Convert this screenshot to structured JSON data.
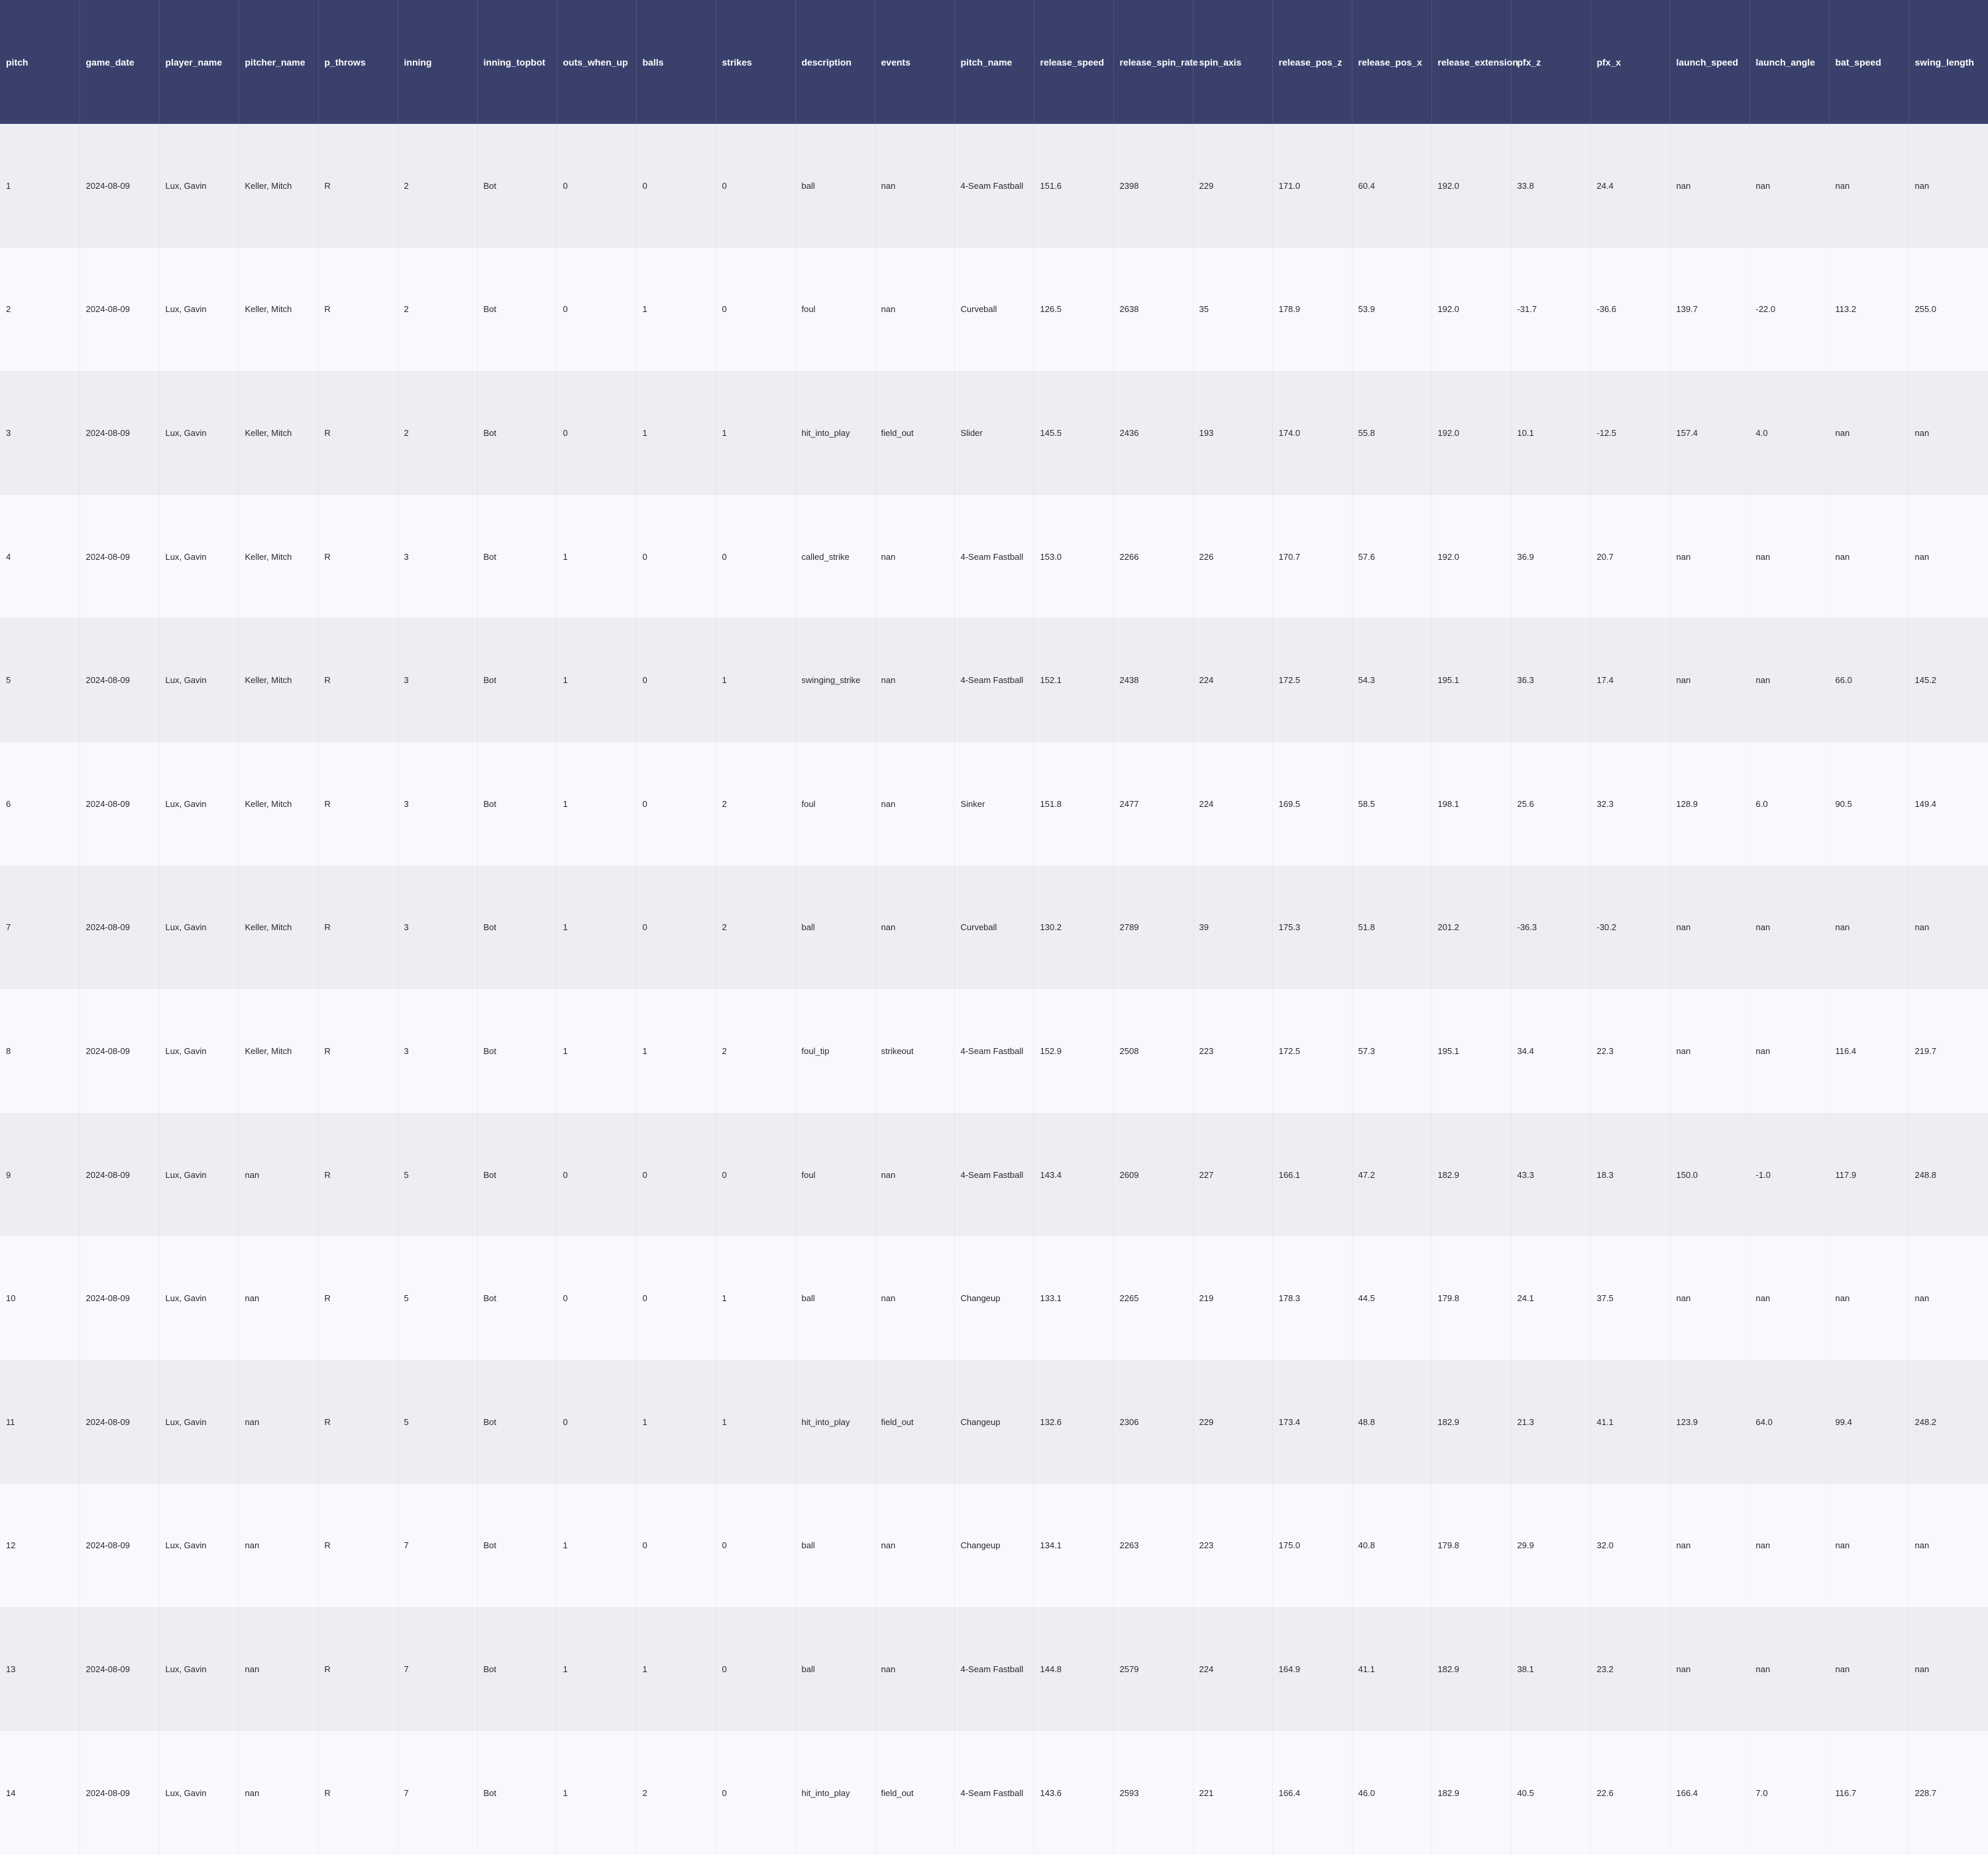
{
  "table": {
    "columns": [
      "pitch",
      "game_date",
      "player_name",
      "pitcher_name",
      "p_throws",
      "inning",
      "inning_topbot",
      "outs_when_up",
      "balls",
      "strikes",
      "description",
      "events",
      "pitch_name",
      "release_speed",
      "release_spin_rate",
      "spin_axis",
      "release_pos_z",
      "release_pos_x",
      "release_extension",
      "pfx_z",
      "pfx_x",
      "launch_speed",
      "launch_angle",
      "bat_speed",
      "swing_length"
    ],
    "rows": [
      [
        "1",
        "2024-08-09",
        "Lux, Gavin",
        "Keller, Mitch",
        "R",
        "2",
        "Bot",
        "0",
        "0",
        "0",
        "ball",
        "nan",
        "4-Seam Fastball",
        "151.6",
        "2398",
        "229",
        "171.0",
        "60.4",
        "192.0",
        "33.8",
        "24.4",
        "nan",
        "nan",
        "nan",
        "nan"
      ],
      [
        "2",
        "2024-08-09",
        "Lux, Gavin",
        "Keller, Mitch",
        "R",
        "2",
        "Bot",
        "0",
        "1",
        "0",
        "foul",
        "nan",
        "Curveball",
        "126.5",
        "2638",
        "35",
        "178.9",
        "53.9",
        "192.0",
        "-31.7",
        "-36.6",
        "139.7",
        "-22.0",
        "113.2",
        "255.0"
      ],
      [
        "3",
        "2024-08-09",
        "Lux, Gavin",
        "Keller, Mitch",
        "R",
        "2",
        "Bot",
        "0",
        "1",
        "1",
        "hit_into_play",
        "field_out",
        "Slider",
        "145.5",
        "2436",
        "193",
        "174.0",
        "55.8",
        "192.0",
        "10.1",
        "-12.5",
        "157.4",
        "4.0",
        "nan",
        "nan"
      ],
      [
        "4",
        "2024-08-09",
        "Lux, Gavin",
        "Keller, Mitch",
        "R",
        "3",
        "Bot",
        "1",
        "0",
        "0",
        "called_strike",
        "nan",
        "4-Seam Fastball",
        "153.0",
        "2266",
        "226",
        "170.7",
        "57.6",
        "192.0",
        "36.9",
        "20.7",
        "nan",
        "nan",
        "nan",
        "nan"
      ],
      [
        "5",
        "2024-08-09",
        "Lux, Gavin",
        "Keller, Mitch",
        "R",
        "3",
        "Bot",
        "1",
        "0",
        "1",
        "swinging_strike",
        "nan",
        "4-Seam Fastball",
        "152.1",
        "2438",
        "224",
        "172.5",
        "54.3",
        "195.1",
        "36.3",
        "17.4",
        "nan",
        "nan",
        "66.0",
        "145.2"
      ],
      [
        "6",
        "2024-08-09",
        "Lux, Gavin",
        "Keller, Mitch",
        "R",
        "3",
        "Bot",
        "1",
        "0",
        "2",
        "foul",
        "nan",
        "Sinker",
        "151.8",
        "2477",
        "224",
        "169.5",
        "58.5",
        "198.1",
        "25.6",
        "32.3",
        "128.9",
        "6.0",
        "90.5",
        "149.4"
      ],
      [
        "7",
        "2024-08-09",
        "Lux, Gavin",
        "Keller, Mitch",
        "R",
        "3",
        "Bot",
        "1",
        "0",
        "2",
        "ball",
        "nan",
        "Curveball",
        "130.2",
        "2789",
        "39",
        "175.3",
        "51.8",
        "201.2",
        "-36.3",
        "-30.2",
        "nan",
        "nan",
        "nan",
        "nan"
      ],
      [
        "8",
        "2024-08-09",
        "Lux, Gavin",
        "Keller, Mitch",
        "R",
        "3",
        "Bot",
        "1",
        "1",
        "2",
        "foul_tip",
        "strikeout",
        "4-Seam Fastball",
        "152.9",
        "2508",
        "223",
        "172.5",
        "57.3",
        "195.1",
        "34.4",
        "22.3",
        "nan",
        "nan",
        "116.4",
        "219.7"
      ],
      [
        "9",
        "2024-08-09",
        "Lux, Gavin",
        "nan",
        "R",
        "5",
        "Bot",
        "0",
        "0",
        "0",
        "foul",
        "nan",
        "4-Seam Fastball",
        "143.4",
        "2609",
        "227",
        "166.1",
        "47.2",
        "182.9",
        "43.3",
        "18.3",
        "150.0",
        "-1.0",
        "117.9",
        "248.8"
      ],
      [
        "10",
        "2024-08-09",
        "Lux, Gavin",
        "nan",
        "R",
        "5",
        "Bot",
        "0",
        "0",
        "1",
        "ball",
        "nan",
        "Changeup",
        "133.1",
        "2265",
        "219",
        "178.3",
        "44.5",
        "179.8",
        "24.1",
        "37.5",
        "nan",
        "nan",
        "nan",
        "nan"
      ],
      [
        "11",
        "2024-08-09",
        "Lux, Gavin",
        "nan",
        "R",
        "5",
        "Bot",
        "0",
        "1",
        "1",
        "hit_into_play",
        "field_out",
        "Changeup",
        "132.6",
        "2306",
        "229",
        "173.4",
        "48.8",
        "182.9",
        "21.3",
        "41.1",
        "123.9",
        "64.0",
        "99.4",
        "248.2"
      ],
      [
        "12",
        "2024-08-09",
        "Lux, Gavin",
        "nan",
        "R",
        "7",
        "Bot",
        "1",
        "0",
        "0",
        "ball",
        "nan",
        "Changeup",
        "134.1",
        "2263",
        "223",
        "175.0",
        "40.8",
        "179.8",
        "29.9",
        "32.0",
        "nan",
        "nan",
        "nan",
        "nan"
      ],
      [
        "13",
        "2024-08-09",
        "Lux, Gavin",
        "nan",
        "R",
        "7",
        "Bot",
        "1",
        "1",
        "0",
        "ball",
        "nan",
        "4-Seam Fastball",
        "144.8",
        "2579",
        "224",
        "164.9",
        "41.1",
        "182.9",
        "38.1",
        "23.2",
        "nan",
        "nan",
        "nan",
        "nan"
      ],
      [
        "14",
        "2024-08-09",
        "Lux, Gavin",
        "nan",
        "R",
        "7",
        "Bot",
        "1",
        "2",
        "0",
        "hit_into_play",
        "field_out",
        "4-Seam Fastball",
        "143.6",
        "2593",
        "221",
        "166.4",
        "46.0",
        "182.9",
        "40.5",
        "22.6",
        "166.4",
        "7.0",
        "116.7",
        "228.7"
      ]
    ]
  },
  "colors": {
    "header_bg": "#39406b",
    "header_text": "#ffffff",
    "row_odd_bg": "#eceef1",
    "row_even_bg": "#f7f9fc"
  }
}
